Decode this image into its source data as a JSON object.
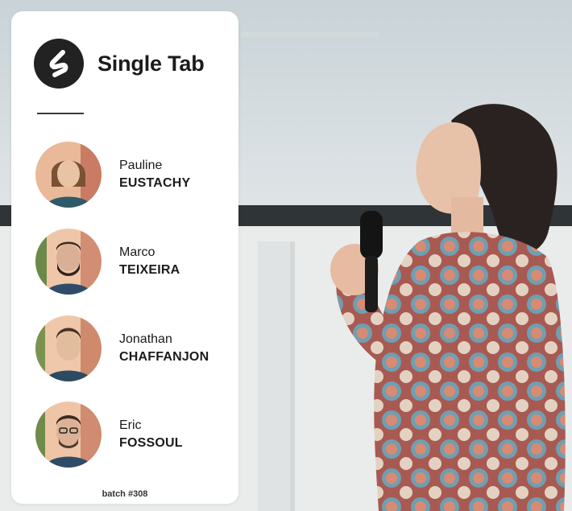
{
  "card": {
    "brand_name": "Single Tab",
    "logo_icon": "single-tab-logo",
    "batch_label": "batch #308"
  },
  "people": [
    {
      "first": "Pauline",
      "last": "EUSTACHY"
    },
    {
      "first": "Marco",
      "last": "TEIXEIRA"
    },
    {
      "first": "Jonathan",
      "last": "CHAFFANJON"
    },
    {
      "first": "Eric",
      "last": "FOSSOUL"
    }
  ],
  "colors": {
    "card_bg": "#ffffff",
    "logo_bg": "#222222",
    "text": "#1b1b1b",
    "avatar_bg": "#e8b89a"
  }
}
